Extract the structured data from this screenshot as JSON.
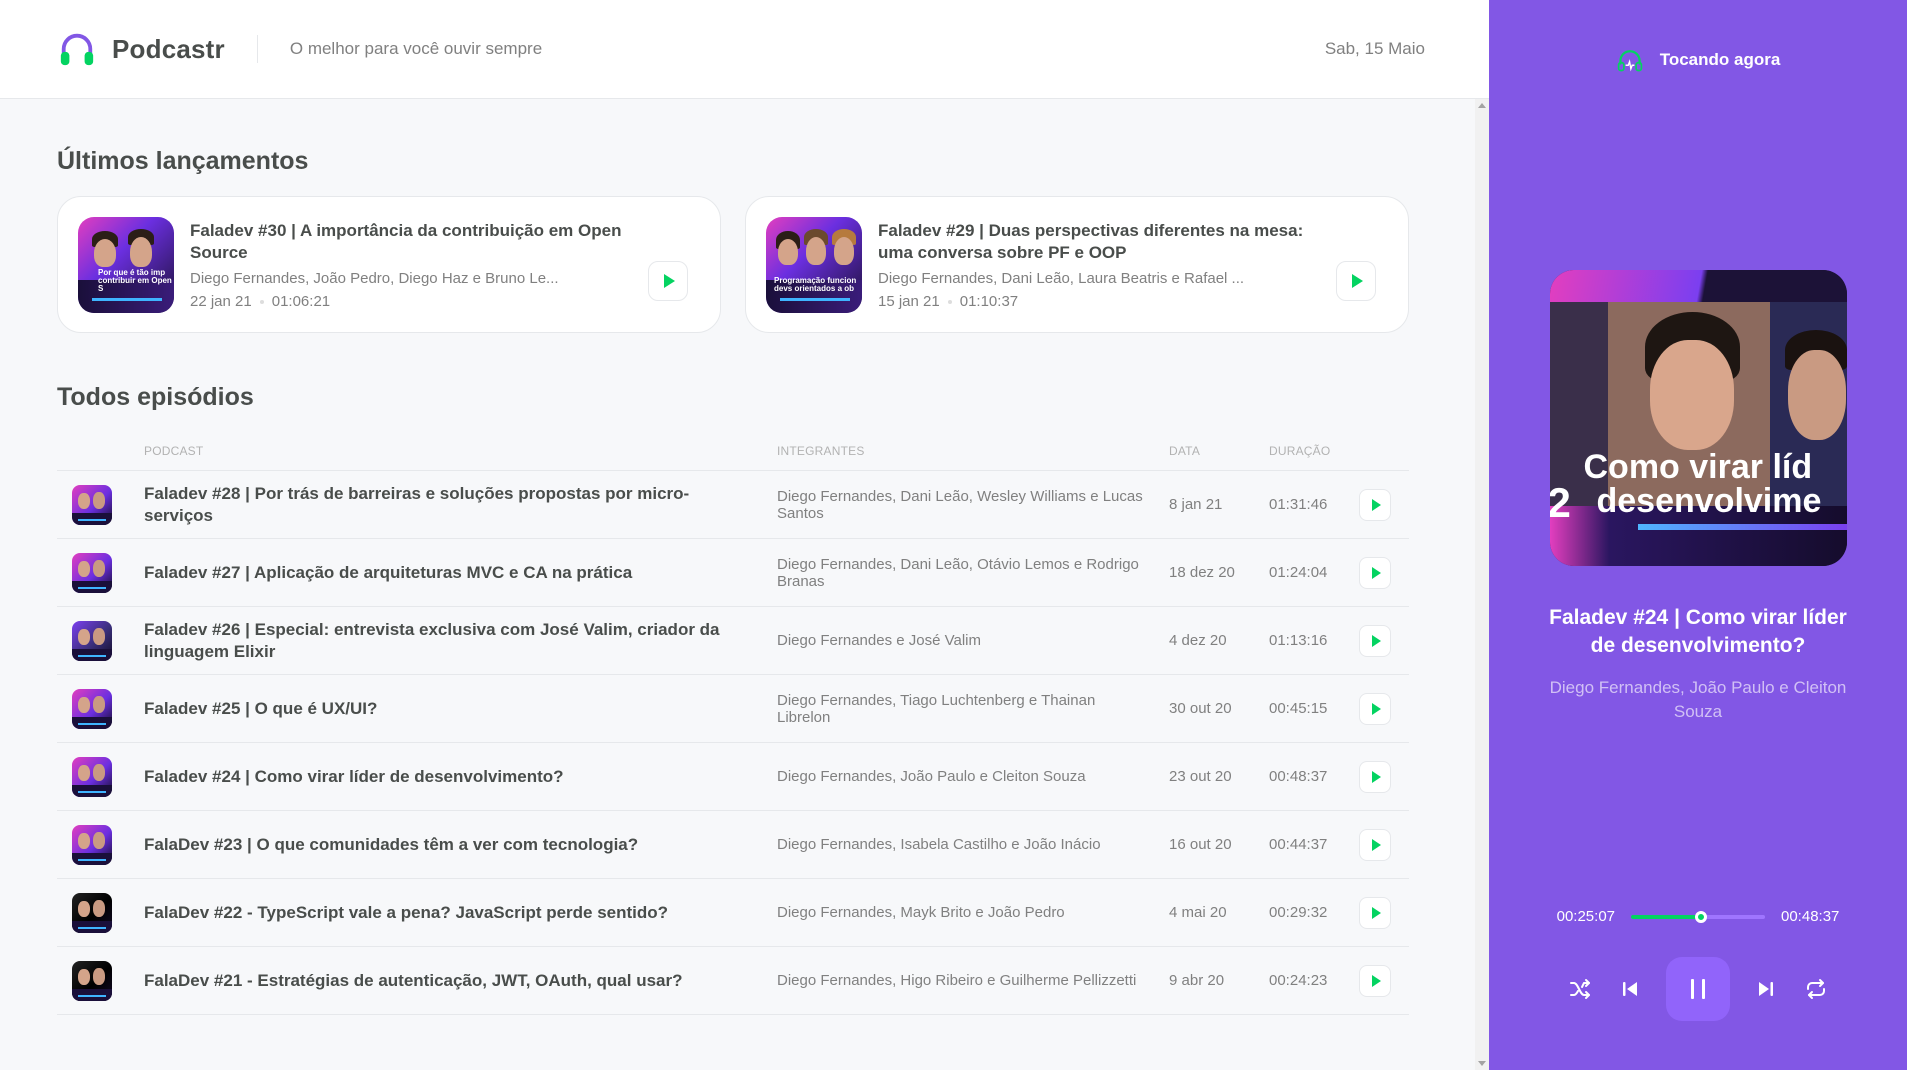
{
  "header": {
    "app_name": "Podcastr",
    "tagline": "O melhor para você ouvir sempre",
    "date": "Sab, 15 Maio"
  },
  "latest": {
    "title": "Últimos lançamentos",
    "items": [
      {
        "title": "Faladev #30 | A importância da contribuição em Open Source",
        "members": "Diego Fernandes, João Pedro, Diego Haz e Bruno Le...",
        "date": "22 jan 21",
        "duration": "01:06:21",
        "thumb_text": "Por que é tão imp contribuir em Open S"
      },
      {
        "title": "Faladev #29 | Duas perspectivas diferentes na mesa: uma conversa sobre PF e OOP",
        "members": "Diego Fernandes, Dani Leão, Laura Beatris e Rafael ...",
        "date": "15 jan 21",
        "duration": "01:10:37",
        "thumb_text": "Programação funcion devs orientados a ob"
      }
    ]
  },
  "all": {
    "title": "Todos episódios",
    "columns": [
      "Podcast",
      "Integrantes",
      "Data",
      "Duração"
    ],
    "rows": [
      {
        "title": "Faladev #28 | Por trás de barreiras e soluções propostas por micro-serviços",
        "members": "Diego Fernandes, Dani Leão, Wesley Williams e Lucas Santos",
        "date": "8 jan 21",
        "duration": "01:31:46"
      },
      {
        "title": "Faladev #27 | Aplicação de arquiteturas MVC e CA na prática",
        "members": "Diego Fernandes, Dani Leão, Otávio Lemos e Rodrigo Branas",
        "date": "18 dez 20",
        "duration": "01:24:04"
      },
      {
        "title": "Faladev #26 | Especial: entrevista exclusiva com José Valim, criador da linguagem Elixir",
        "members": "Diego Fernandes e José Valim",
        "date": "4 dez 20",
        "duration": "01:13:16"
      },
      {
        "title": "Faladev #25 | O que é UX/UI?",
        "members": "Diego Fernandes, Tiago Luchtenberg e Thainan Librelon",
        "date": "30 out 20",
        "duration": "00:45:15"
      },
      {
        "title": "Faladev #24 | Como virar líder de desenvolvimento?",
        "members": "Diego Fernandes, João Paulo e Cleiton Souza",
        "date": "23 out 20",
        "duration": "00:48:37"
      },
      {
        "title": "FalaDev #23 | O que comunidades têm a ver com tecnologia?",
        "members": "Diego Fernandes, Isabela Castilho e João Inácio",
        "date": "16 out 20",
        "duration": "00:44:37"
      },
      {
        "title": "FalaDev #22 - TypeScript vale a pena? JavaScript perde sentido?",
        "members": "Diego Fernandes, Mayk Brito e João Pedro",
        "date": "4 mai 20",
        "duration": "00:29:32"
      },
      {
        "title": "FalaDev #21 - Estratégias de autenticação, JWT, OAuth, qual usar?",
        "members": "Diego Fernandes, Higo Ribeiro e Guilherme Pellizzetti",
        "date": "9 abr 20",
        "duration": "00:24:23"
      }
    ]
  },
  "player": {
    "header": "Tocando agora",
    "cover_text_1": "Como virar líd",
    "cover_text_2": "desenvolvime",
    "cover_number": "2",
    "title": "Faladev #24 | Como virar líder de desenvolvimento?",
    "members": "Diego Fernandes, João Paulo e Cleiton Souza",
    "elapsed": "00:25:07",
    "total": "00:48:37",
    "progress_fraction": 0.52
  },
  "colors": {
    "brand_purple": "#8257e5",
    "accent_green": "#04d361",
    "text_dark": "#494d4b",
    "text_muted": "#808080"
  }
}
